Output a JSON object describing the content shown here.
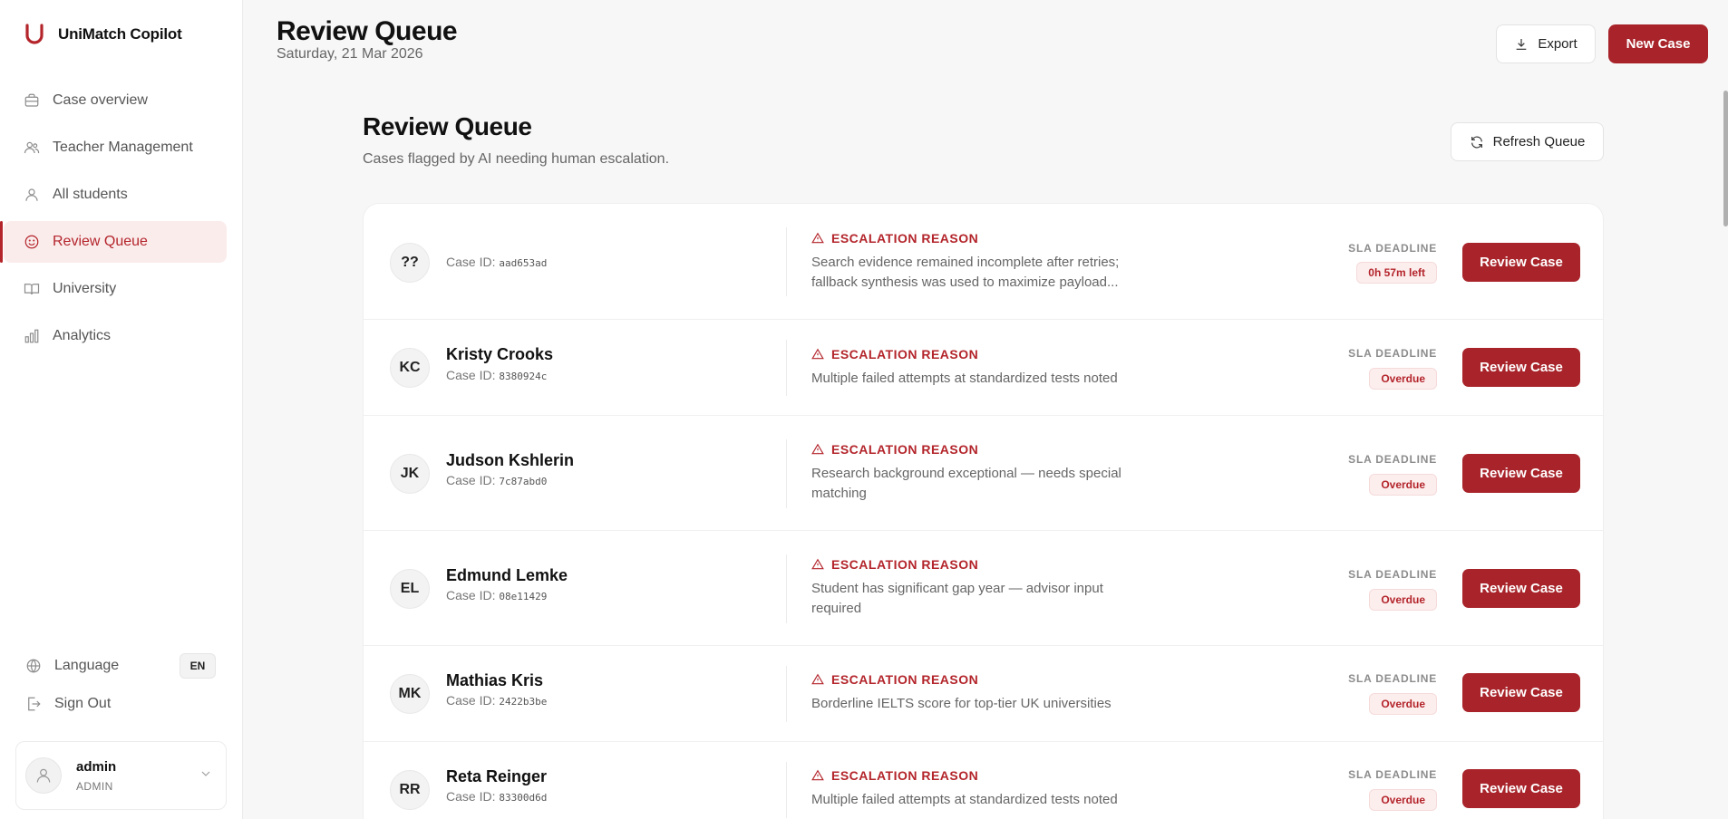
{
  "brand": {
    "name": "UniMatch Copilot",
    "accent": "#a8242a"
  },
  "sidebar": {
    "items": [
      {
        "label": "Case overview",
        "icon": "briefcase-icon"
      },
      {
        "label": "Teacher Management",
        "icon": "users-icon"
      },
      {
        "label": "All students",
        "icon": "user-icon"
      },
      {
        "label": "Review Queue",
        "icon": "smile-icon",
        "active": true
      },
      {
        "label": "University",
        "icon": "book-icon"
      },
      {
        "label": "Analytics",
        "icon": "bar-chart-icon"
      }
    ],
    "language_label": "Language",
    "language_value": "EN",
    "signout_label": "Sign Out",
    "user": {
      "name": "admin",
      "role": "ADMIN"
    }
  },
  "header": {
    "title": "Review Queue",
    "date": "Saturday, 21 Mar 2026",
    "export_label": "Export",
    "new_case_label": "New Case"
  },
  "main": {
    "title": "Review Queue",
    "subtitle": "Cases flagged by AI needing human escalation.",
    "refresh_label": "Refresh Queue",
    "case_id_prefix": "Case ID:",
    "escalation_label": "ESCALATION REASON",
    "sla_label": "SLA DEADLINE",
    "review_label": "Review Case",
    "rows": [
      {
        "initials": "??",
        "name": "",
        "case_id": "aad653ad",
        "reason": "Search evidence remained incomplete after retries; fallback synthesis was used to maximize payload...",
        "sla": "0h 57m left"
      },
      {
        "initials": "KC",
        "name": "Kristy Crooks",
        "case_id": "8380924c",
        "reason": "Multiple failed attempts at standardized tests noted",
        "sla": "Overdue"
      },
      {
        "initials": "JK",
        "name": "Judson Kshlerin",
        "case_id": "7c87abd0",
        "reason": "Research background exceptional — needs special matching",
        "sla": "Overdue"
      },
      {
        "initials": "EL",
        "name": "Edmund Lemke",
        "case_id": "08e11429",
        "reason": "Student has significant gap year — advisor input required",
        "sla": "Overdue"
      },
      {
        "initials": "MK",
        "name": "Mathias Kris",
        "case_id": "2422b3be",
        "reason": "Borderline IELTS score for top-tier UK universities",
        "sla": "Overdue"
      },
      {
        "initials": "RR",
        "name": "Reta Reinger",
        "case_id": "83300d6d",
        "reason": "Multiple failed attempts at standardized tests noted",
        "sla": "Overdue"
      }
    ]
  }
}
